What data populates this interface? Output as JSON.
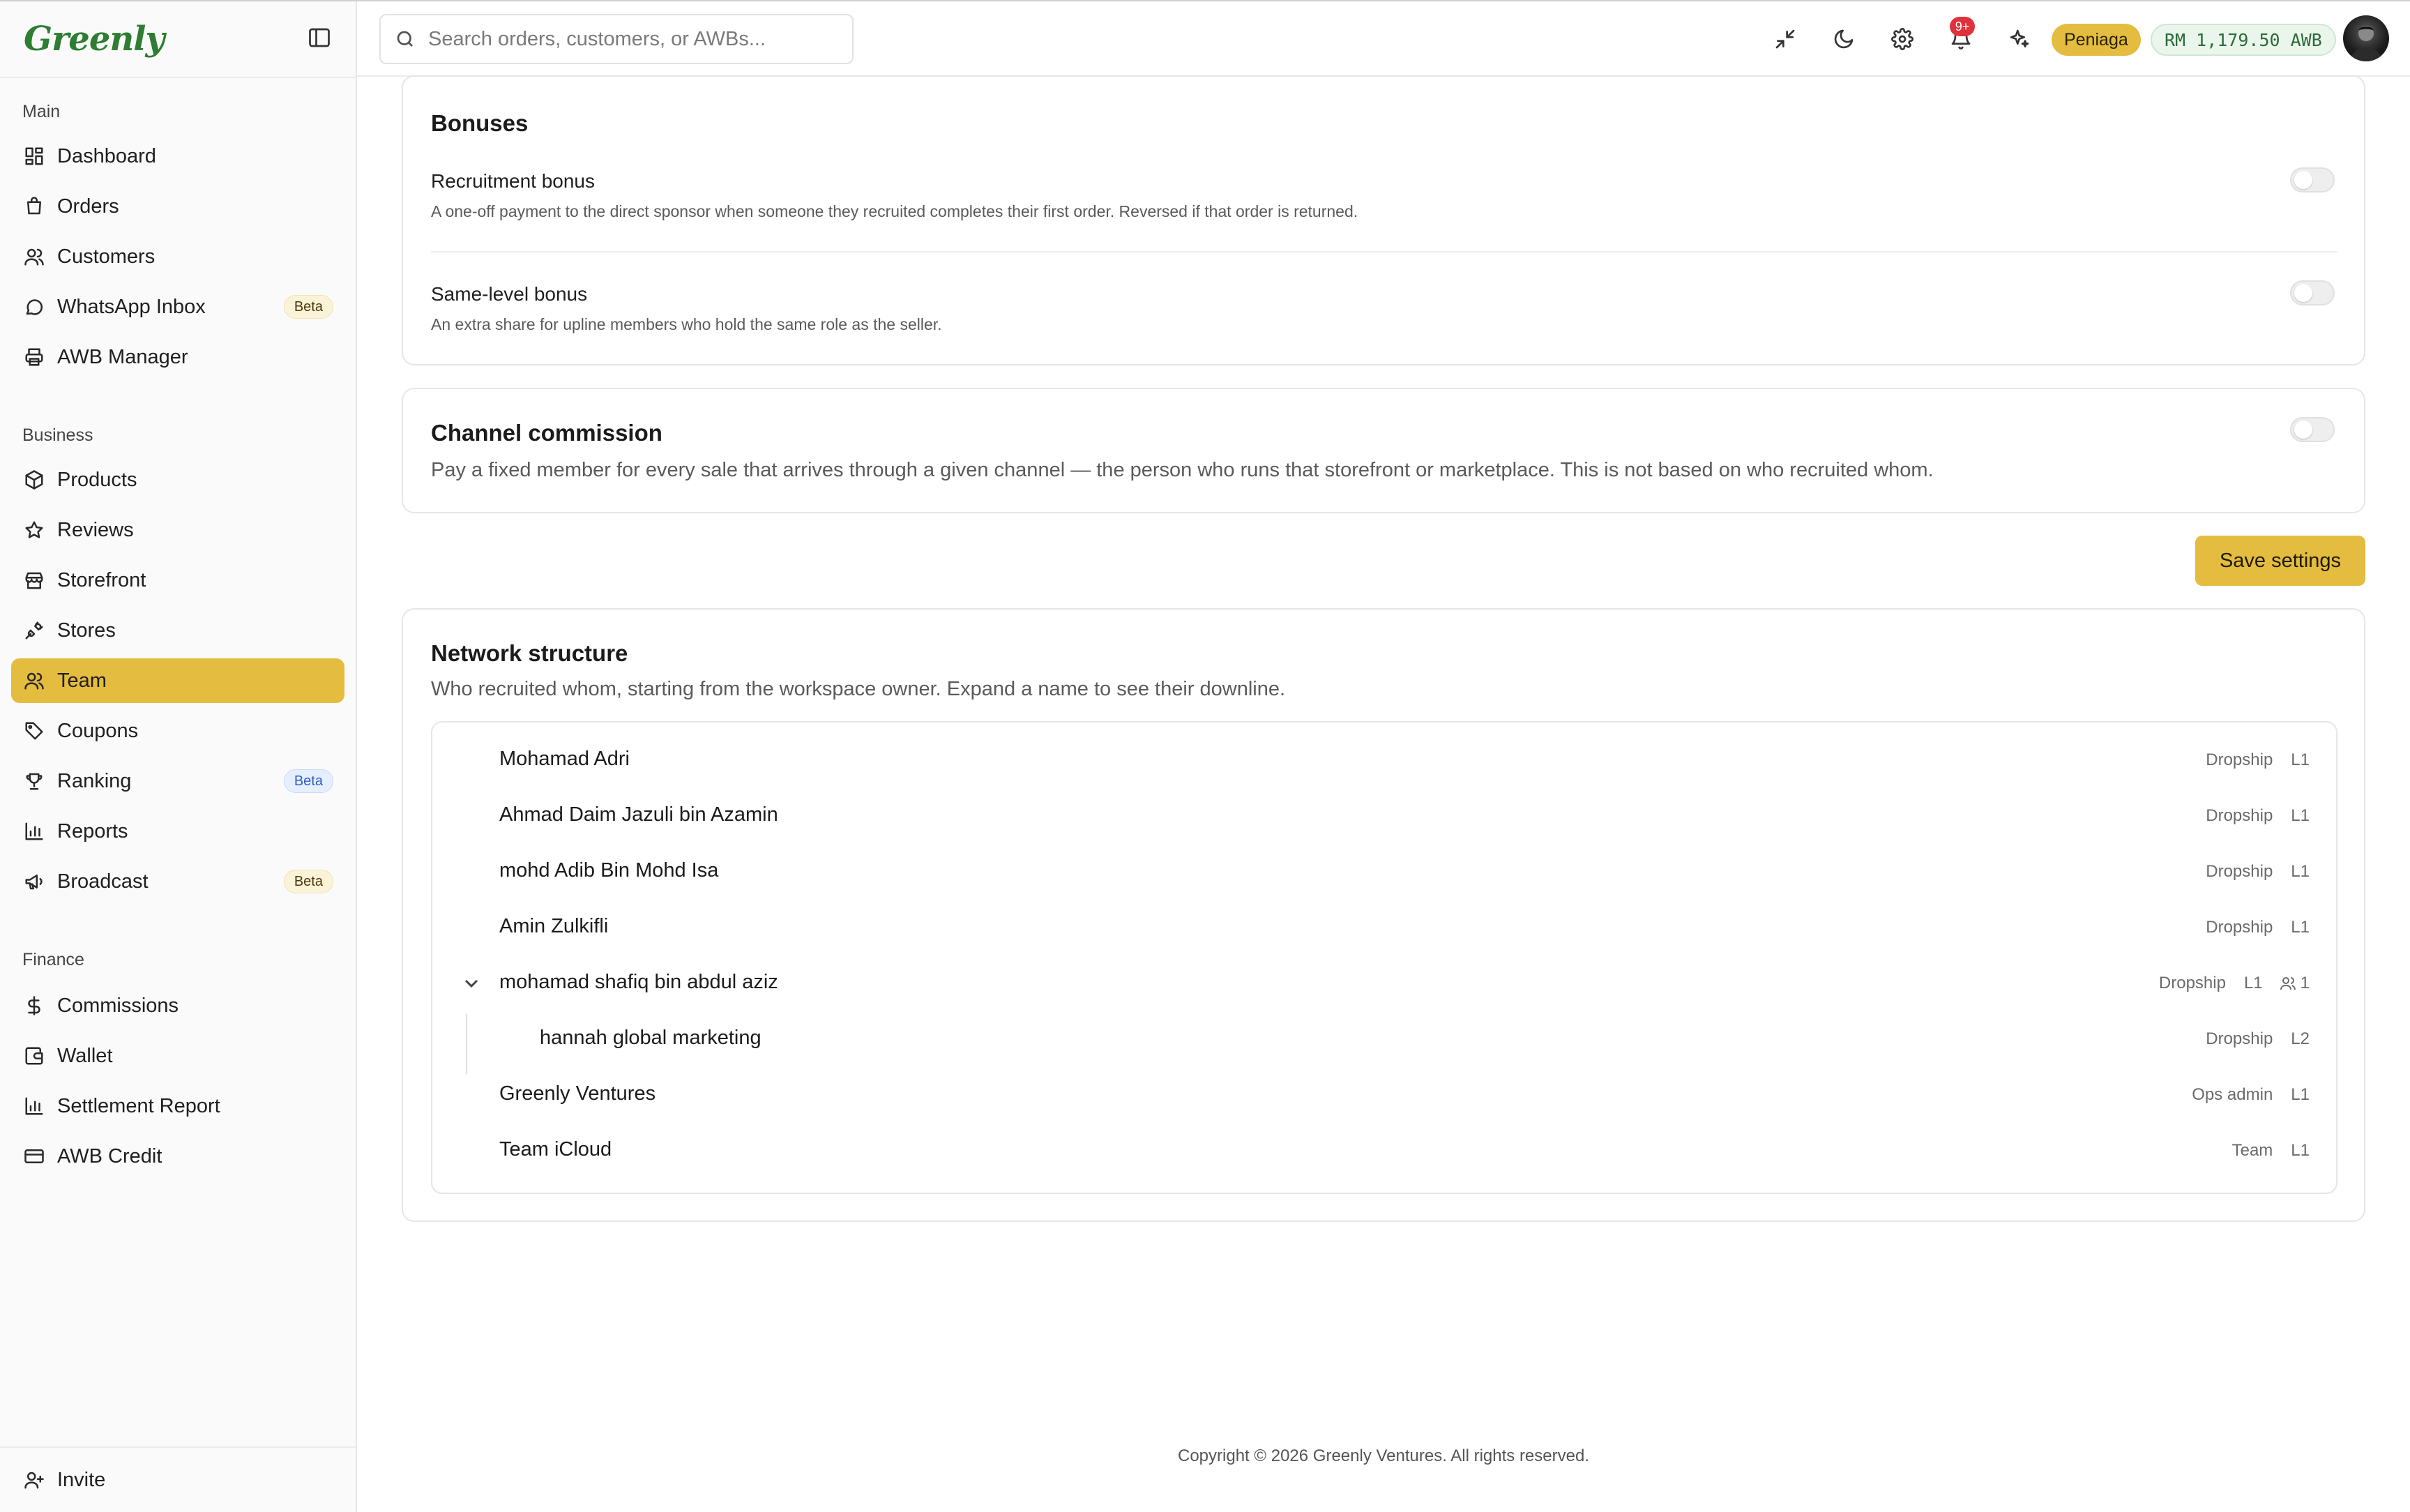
{
  "brand": {
    "name": "Greenly",
    "brand_color": "#2f7d32"
  },
  "accent_color": "#e4bc3f",
  "search": {
    "placeholder": "Search orders, customers, or AWBs..."
  },
  "topbar": {
    "notification_count": "9+",
    "plan_label": "Peniaga",
    "balance": "RM 1,179.50 AWB",
    "icons": [
      "collapse-icon",
      "moon-icon",
      "gear-icon",
      "bell-icon",
      "sparkles-icon"
    ]
  },
  "sidebar": {
    "sections": [
      {
        "title": "Main",
        "items": [
          {
            "label": "Dashboard",
            "icon": "dashboard-icon"
          },
          {
            "label": "Orders",
            "icon": "orders-icon"
          },
          {
            "label": "Customers",
            "icon": "users-icon"
          },
          {
            "label": "WhatsApp Inbox",
            "icon": "chat-icon",
            "badge": "Beta"
          },
          {
            "label": "AWB Manager",
            "icon": "printer-icon"
          }
        ]
      },
      {
        "title": "Business",
        "items": [
          {
            "label": "Products",
            "icon": "box-icon"
          },
          {
            "label": "Reviews",
            "icon": "star-icon"
          },
          {
            "label": "Storefront",
            "icon": "store-icon"
          },
          {
            "label": "Stores",
            "icon": "plug-icon"
          },
          {
            "label": "Team",
            "icon": "users-icon",
            "active": true
          },
          {
            "label": "Coupons",
            "icon": "tag-icon"
          },
          {
            "label": "Ranking",
            "icon": "trophy-icon",
            "badge": "Beta"
          },
          {
            "label": "Reports",
            "icon": "bar-chart-icon"
          },
          {
            "label": "Broadcast",
            "icon": "megaphone-icon",
            "badge": "Beta"
          }
        ]
      },
      {
        "title": "Finance",
        "items": [
          {
            "label": "Commissions",
            "icon": "dollar-icon"
          },
          {
            "label": "Wallet",
            "icon": "wallet-icon"
          },
          {
            "label": "Settlement Report",
            "icon": "bar-chart-icon"
          },
          {
            "label": "AWB Credit",
            "icon": "credit-card-icon"
          }
        ]
      }
    ],
    "invite_label": "Invite"
  },
  "bonuses": {
    "title": "Bonuses",
    "recruitment": {
      "title": "Recruitment bonus",
      "desc": "A one-off payment to the direct sponsor when someone they recruited completes their first order. Reversed if that order is returned.",
      "enabled": false
    },
    "same_level": {
      "title": "Same-level bonus",
      "desc": "An extra share for upline members who hold the same role as the seller.",
      "enabled": false
    }
  },
  "channel": {
    "title": "Channel commission",
    "desc": "Pay a fixed member for every sale that arrives through a given channel — the person who runs that storefront or marketplace. This is not based on who recruited whom.",
    "enabled": false
  },
  "save_label": "Save settings",
  "network": {
    "title": "Network structure",
    "subtitle": "Who recruited whom, starting from the workspace owner. Expand a name to see their downline.",
    "members": [
      {
        "name": "Mohamad Adri",
        "role": "Dropship",
        "level": "L1"
      },
      {
        "name": "Ahmad Daim Jazuli bin Azamin",
        "role": "Dropship",
        "level": "L1"
      },
      {
        "name": "mohd Adib Bin Mohd Isa",
        "role": "Dropship",
        "level": "L1"
      },
      {
        "name": "Amin Zulkifli",
        "role": "Dropship",
        "level": "L1"
      },
      {
        "name": "mohamad shafiq bin abdul aziz",
        "role": "Dropship",
        "level": "L1",
        "downline": "1",
        "expanded": true
      },
      {
        "name": "hannah global marketing",
        "role": "Dropship",
        "level": "L2",
        "child": true
      },
      {
        "name": "Greenly Ventures",
        "role": "Ops admin",
        "level": "L1"
      },
      {
        "name": "Team iCloud",
        "role": "Team",
        "level": "L1"
      }
    ]
  },
  "footer": {
    "copyright": "Copyright © 2026 Greenly Ventures. All rights reserved."
  }
}
